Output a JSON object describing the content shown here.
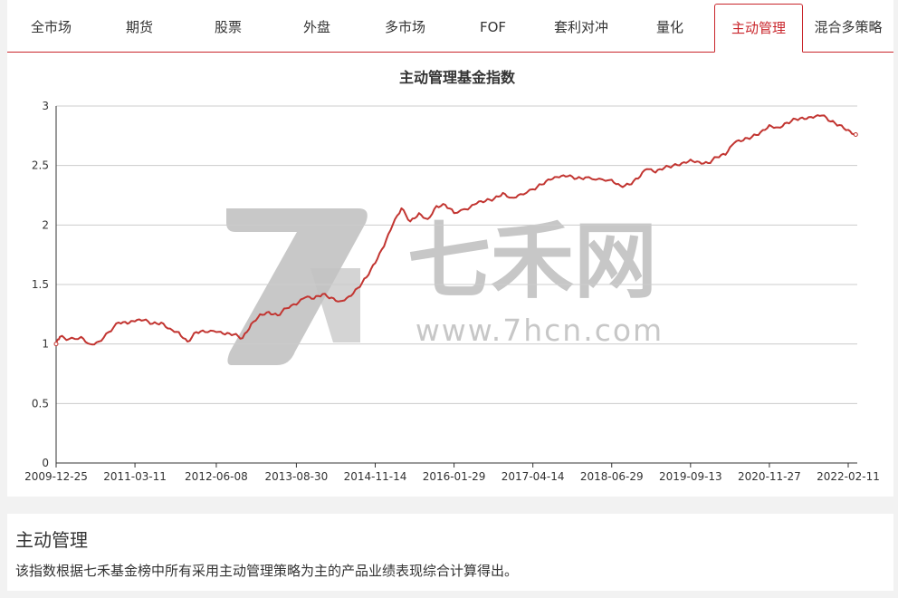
{
  "tabs": [
    {
      "label": "全市场",
      "active": false
    },
    {
      "label": "期货",
      "active": false
    },
    {
      "label": "股票",
      "active": false
    },
    {
      "label": "外盘",
      "active": false
    },
    {
      "label": "多市场",
      "active": false
    },
    {
      "label": "FOF",
      "active": false
    },
    {
      "label": "套利对冲",
      "active": false
    },
    {
      "label": "量化",
      "active": false
    },
    {
      "label": "主动管理",
      "active": true
    },
    {
      "label": "混合多策略",
      "active": false
    }
  ],
  "watermark": {
    "text": "七禾网",
    "url": "www.7hcn.com"
  },
  "colors": {
    "accent": "#c9252b",
    "line": "#c23531",
    "grid": "#cccccc",
    "watermark": "#c2c2c2"
  },
  "chart_data": {
    "type": "line",
    "title": "主动管理基金指数",
    "xlabel": "",
    "ylabel": "",
    "ylim": [
      0,
      3
    ],
    "yticks": [
      0,
      0.5,
      1,
      1.5,
      2,
      2.5,
      3
    ],
    "xticks": [
      "2009-12-25",
      "2011-03-11",
      "2012-06-08",
      "2013-08-30",
      "2014-11-14",
      "2016-01-29",
      "2017-04-14",
      "2018-06-29",
      "2019-09-13",
      "2020-11-27",
      "2022-02-11"
    ],
    "grid": true,
    "series": [
      {
        "x": [
          "2009-12-25",
          "2010-01-15",
          "2010-03-05",
          "2010-05-14",
          "2010-07-02",
          "2010-08-20",
          "2010-10-15",
          "2010-12-10",
          "2011-01-28",
          "2011-03-11",
          "2011-04-29",
          "2011-06-17",
          "2011-08-05",
          "2011-09-23",
          "2011-11-11",
          "2011-12-30",
          "2012-02-17",
          "2012-04-06",
          "2012-06-08",
          "2012-07-27",
          "2012-09-14",
          "2012-11-02",
          "2012-12-21",
          "2013-02-08",
          "2013-03-29",
          "2013-05-17",
          "2013-07-05",
          "2013-08-30",
          "2013-10-18",
          "2013-12-06",
          "2014-01-24",
          "2014-03-14",
          "2014-05-02",
          "2014-06-20",
          "2014-08-08",
          "2014-09-26",
          "2014-11-14",
          "2015-01-02",
          "2015-02-20",
          "2015-04-10",
          "2015-05-29",
          "2015-07-17",
          "2015-09-04",
          "2015-10-23",
          "2015-12-11",
          "2016-01-29",
          "2016-04-15",
          "2016-06-03",
          "2016-07-22",
          "2016-09-09",
          "2016-10-28",
          "2016-12-16",
          "2017-02-03",
          "2017-04-14",
          "2017-06-02",
          "2017-07-21",
          "2017-09-08",
          "2017-10-27",
          "2017-12-15",
          "2018-02-02",
          "2018-04-20",
          "2018-06-29",
          "2018-08-17",
          "2018-10-05",
          "2018-11-23",
          "2019-01-11",
          "2019-03-01",
          "2019-04-19",
          "2019-06-07",
          "2019-07-26",
          "2019-09-13",
          "2019-11-01",
          "2019-12-20",
          "2020-02-07",
          "2020-03-27",
          "2020-05-15",
          "2020-07-03",
          "2020-08-21",
          "2020-10-09",
          "2020-11-27",
          "2021-01-15",
          "2021-03-05",
          "2021-04-23",
          "2021-06-11",
          "2021-07-30",
          "2021-09-17",
          "2021-11-05",
          "2021-12-24",
          "2022-02-11",
          "2022-03-25"
        ],
        "values": [
          1.0,
          1.06,
          1.04,
          1.06,
          1.0,
          1.02,
          1.1,
          1.18,
          1.17,
          1.19,
          1.2,
          1.17,
          1.18,
          1.13,
          1.1,
          1.02,
          1.1,
          1.1,
          1.1,
          1.08,
          1.08,
          1.05,
          1.17,
          1.25,
          1.27,
          1.24,
          1.3,
          1.33,
          1.39,
          1.38,
          1.42,
          1.39,
          1.36,
          1.4,
          1.47,
          1.56,
          1.68,
          1.82,
          2.0,
          2.14,
          2.03,
          2.1,
          2.05,
          2.16,
          2.17,
          2.1,
          2.13,
          2.18,
          2.2,
          2.22,
          2.27,
          2.23,
          2.26,
          2.3,
          2.34,
          2.38,
          2.4,
          2.41,
          2.39,
          2.4,
          2.39,
          2.38,
          2.33,
          2.34,
          2.39,
          2.47,
          2.44,
          2.48,
          2.5,
          2.52,
          2.55,
          2.53,
          2.52,
          2.57,
          2.59,
          2.69,
          2.71,
          2.74,
          2.78,
          2.84,
          2.82,
          2.86,
          2.89,
          2.89,
          2.9,
          2.92,
          2.87,
          2.84,
          2.8,
          2.76
        ]
      }
    ]
  },
  "description": {
    "title": "主动管理",
    "text": "该指数根据七禾基金榜中所有采用主动管理策略为主的产品业绩表现综合计算得出。"
  }
}
